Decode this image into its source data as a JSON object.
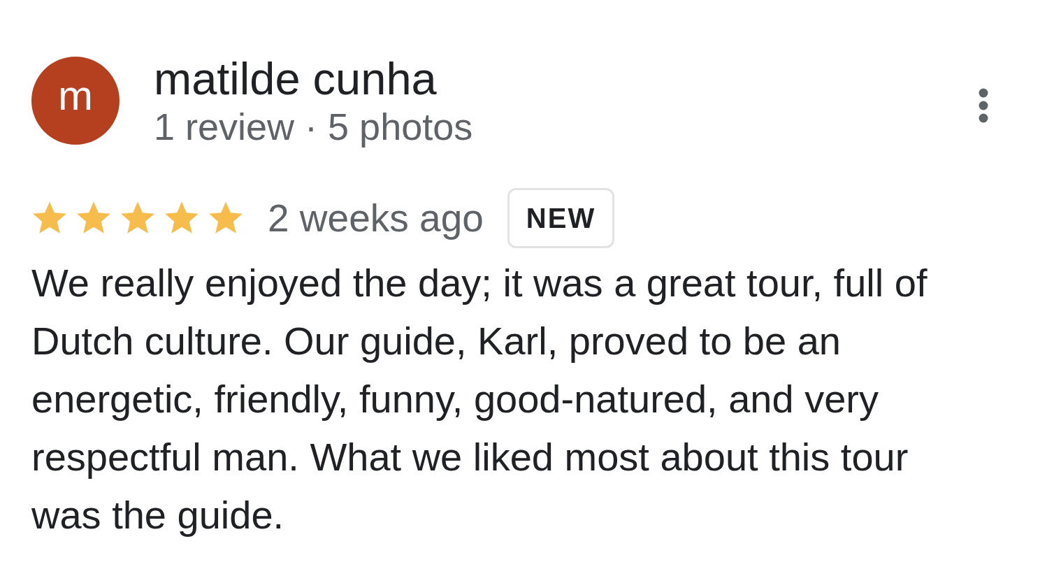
{
  "review": {
    "author": {
      "initial": "m",
      "name": "matilde cunha",
      "meta": "1 review · 5 photos"
    },
    "stars": 5,
    "time": "2 weeks ago",
    "badge": "NEW",
    "text": "We really enjoyed the day; it was a great tour, full of Dutch culture. Our guide, Karl, proved to be an energetic, friendly, funny, good-natured, and very respectful man. What we liked most about this tour was the guide."
  }
}
